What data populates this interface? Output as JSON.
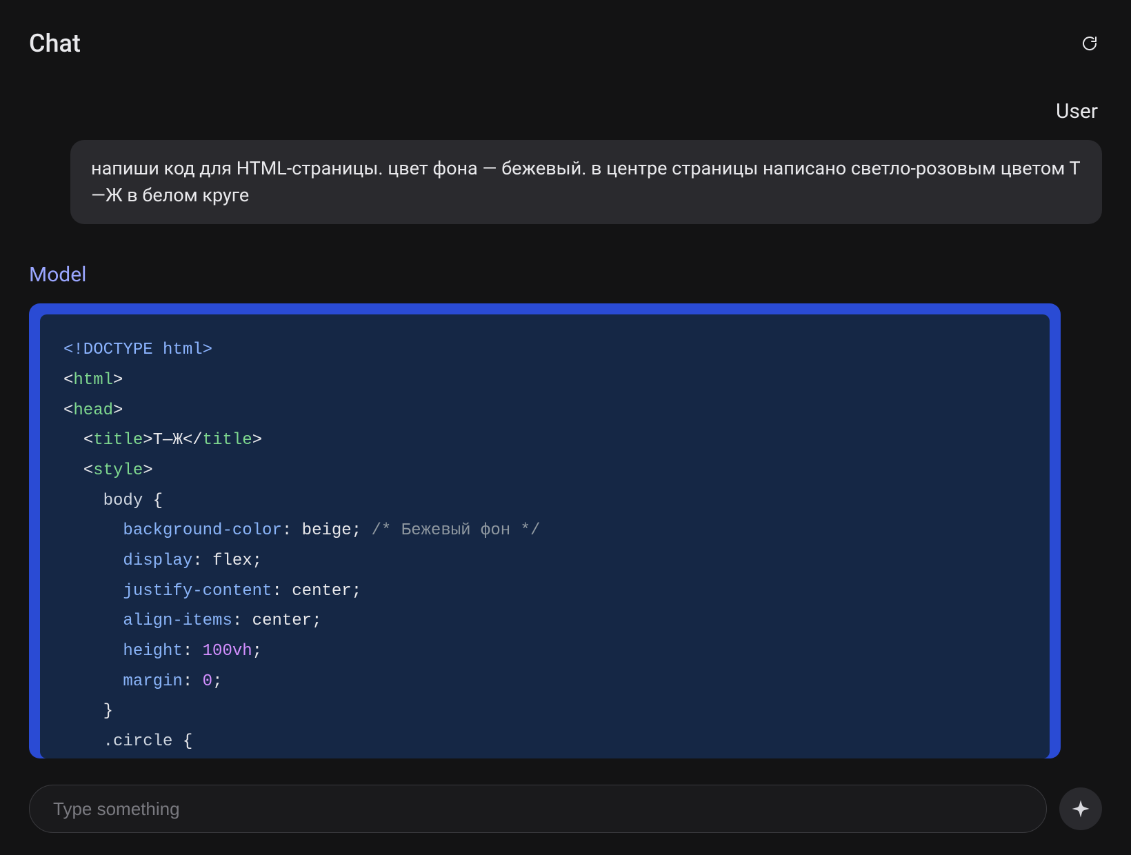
{
  "header": {
    "title": "Chat"
  },
  "conversation": {
    "user_label": "User",
    "model_label": "Model",
    "user_message": "напиши код для HTML-страницы. цвет фона — бежевый. в центре страницы написано светло-розовым цветом Т—Ж в белом круге",
    "model_code": {
      "language": "html",
      "tokens": [
        {
          "cls": "t-doctype",
          "text": "<!DOCTYPE html>"
        },
        {
          "cls": "br"
        },
        {
          "cls": "t-punct",
          "text": "<"
        },
        {
          "cls": "t-tag",
          "text": "html"
        },
        {
          "cls": "t-punct",
          "text": ">"
        },
        {
          "cls": "br"
        },
        {
          "cls": "t-punct",
          "text": "<"
        },
        {
          "cls": "t-tag",
          "text": "head"
        },
        {
          "cls": "t-punct",
          "text": ">"
        },
        {
          "cls": "br"
        },
        {
          "cls": "",
          "text": "  "
        },
        {
          "cls": "t-punct",
          "text": "<"
        },
        {
          "cls": "t-tag",
          "text": "title"
        },
        {
          "cls": "t-punct",
          "text": ">"
        },
        {
          "cls": "t-value",
          "text": "Т—Ж"
        },
        {
          "cls": "t-punct",
          "text": "</"
        },
        {
          "cls": "t-tag",
          "text": "title"
        },
        {
          "cls": "t-punct",
          "text": ">"
        },
        {
          "cls": "br"
        },
        {
          "cls": "",
          "text": "  "
        },
        {
          "cls": "t-punct",
          "text": "<"
        },
        {
          "cls": "t-tag",
          "text": "style"
        },
        {
          "cls": "t-punct",
          "text": ">"
        },
        {
          "cls": "br"
        },
        {
          "cls": "",
          "text": "    "
        },
        {
          "cls": "t-ident",
          "text": "body"
        },
        {
          "cls": "t-punct",
          "text": " {"
        },
        {
          "cls": "br"
        },
        {
          "cls": "",
          "text": "      "
        },
        {
          "cls": "t-prop",
          "text": "background-color"
        },
        {
          "cls": "t-punct",
          "text": ": "
        },
        {
          "cls": "t-value",
          "text": "beige"
        },
        {
          "cls": "t-punct",
          "text": "; "
        },
        {
          "cls": "t-comment",
          "text": "/* Бежевый фон */"
        },
        {
          "cls": "br"
        },
        {
          "cls": "",
          "text": "      "
        },
        {
          "cls": "t-prop",
          "text": "display"
        },
        {
          "cls": "t-punct",
          "text": ": "
        },
        {
          "cls": "t-value",
          "text": "flex"
        },
        {
          "cls": "t-punct",
          "text": ";"
        },
        {
          "cls": "br"
        },
        {
          "cls": "",
          "text": "      "
        },
        {
          "cls": "t-prop",
          "text": "justify-content"
        },
        {
          "cls": "t-punct",
          "text": ": "
        },
        {
          "cls": "t-value",
          "text": "center"
        },
        {
          "cls": "t-punct",
          "text": ";"
        },
        {
          "cls": "br"
        },
        {
          "cls": "",
          "text": "      "
        },
        {
          "cls": "t-prop",
          "text": "align-items"
        },
        {
          "cls": "t-punct",
          "text": ": "
        },
        {
          "cls": "t-value",
          "text": "center"
        },
        {
          "cls": "t-punct",
          "text": ";"
        },
        {
          "cls": "br"
        },
        {
          "cls": "",
          "text": "      "
        },
        {
          "cls": "t-prop",
          "text": "height"
        },
        {
          "cls": "t-punct",
          "text": ": "
        },
        {
          "cls": "t-number",
          "text": "100vh"
        },
        {
          "cls": "t-punct",
          "text": ";"
        },
        {
          "cls": "br"
        },
        {
          "cls": "",
          "text": "      "
        },
        {
          "cls": "t-prop",
          "text": "margin"
        },
        {
          "cls": "t-punct",
          "text": ": "
        },
        {
          "cls": "t-number",
          "text": "0"
        },
        {
          "cls": "t-punct",
          "text": ";"
        },
        {
          "cls": "br"
        },
        {
          "cls": "",
          "text": "    "
        },
        {
          "cls": "t-punct",
          "text": "}"
        },
        {
          "cls": "br"
        },
        {
          "cls": "",
          "text": "    "
        },
        {
          "cls": "t-ident",
          "text": ".circle"
        },
        {
          "cls": "t-punct",
          "text": " {"
        }
      ]
    }
  },
  "composer": {
    "placeholder": "Type something"
  }
}
